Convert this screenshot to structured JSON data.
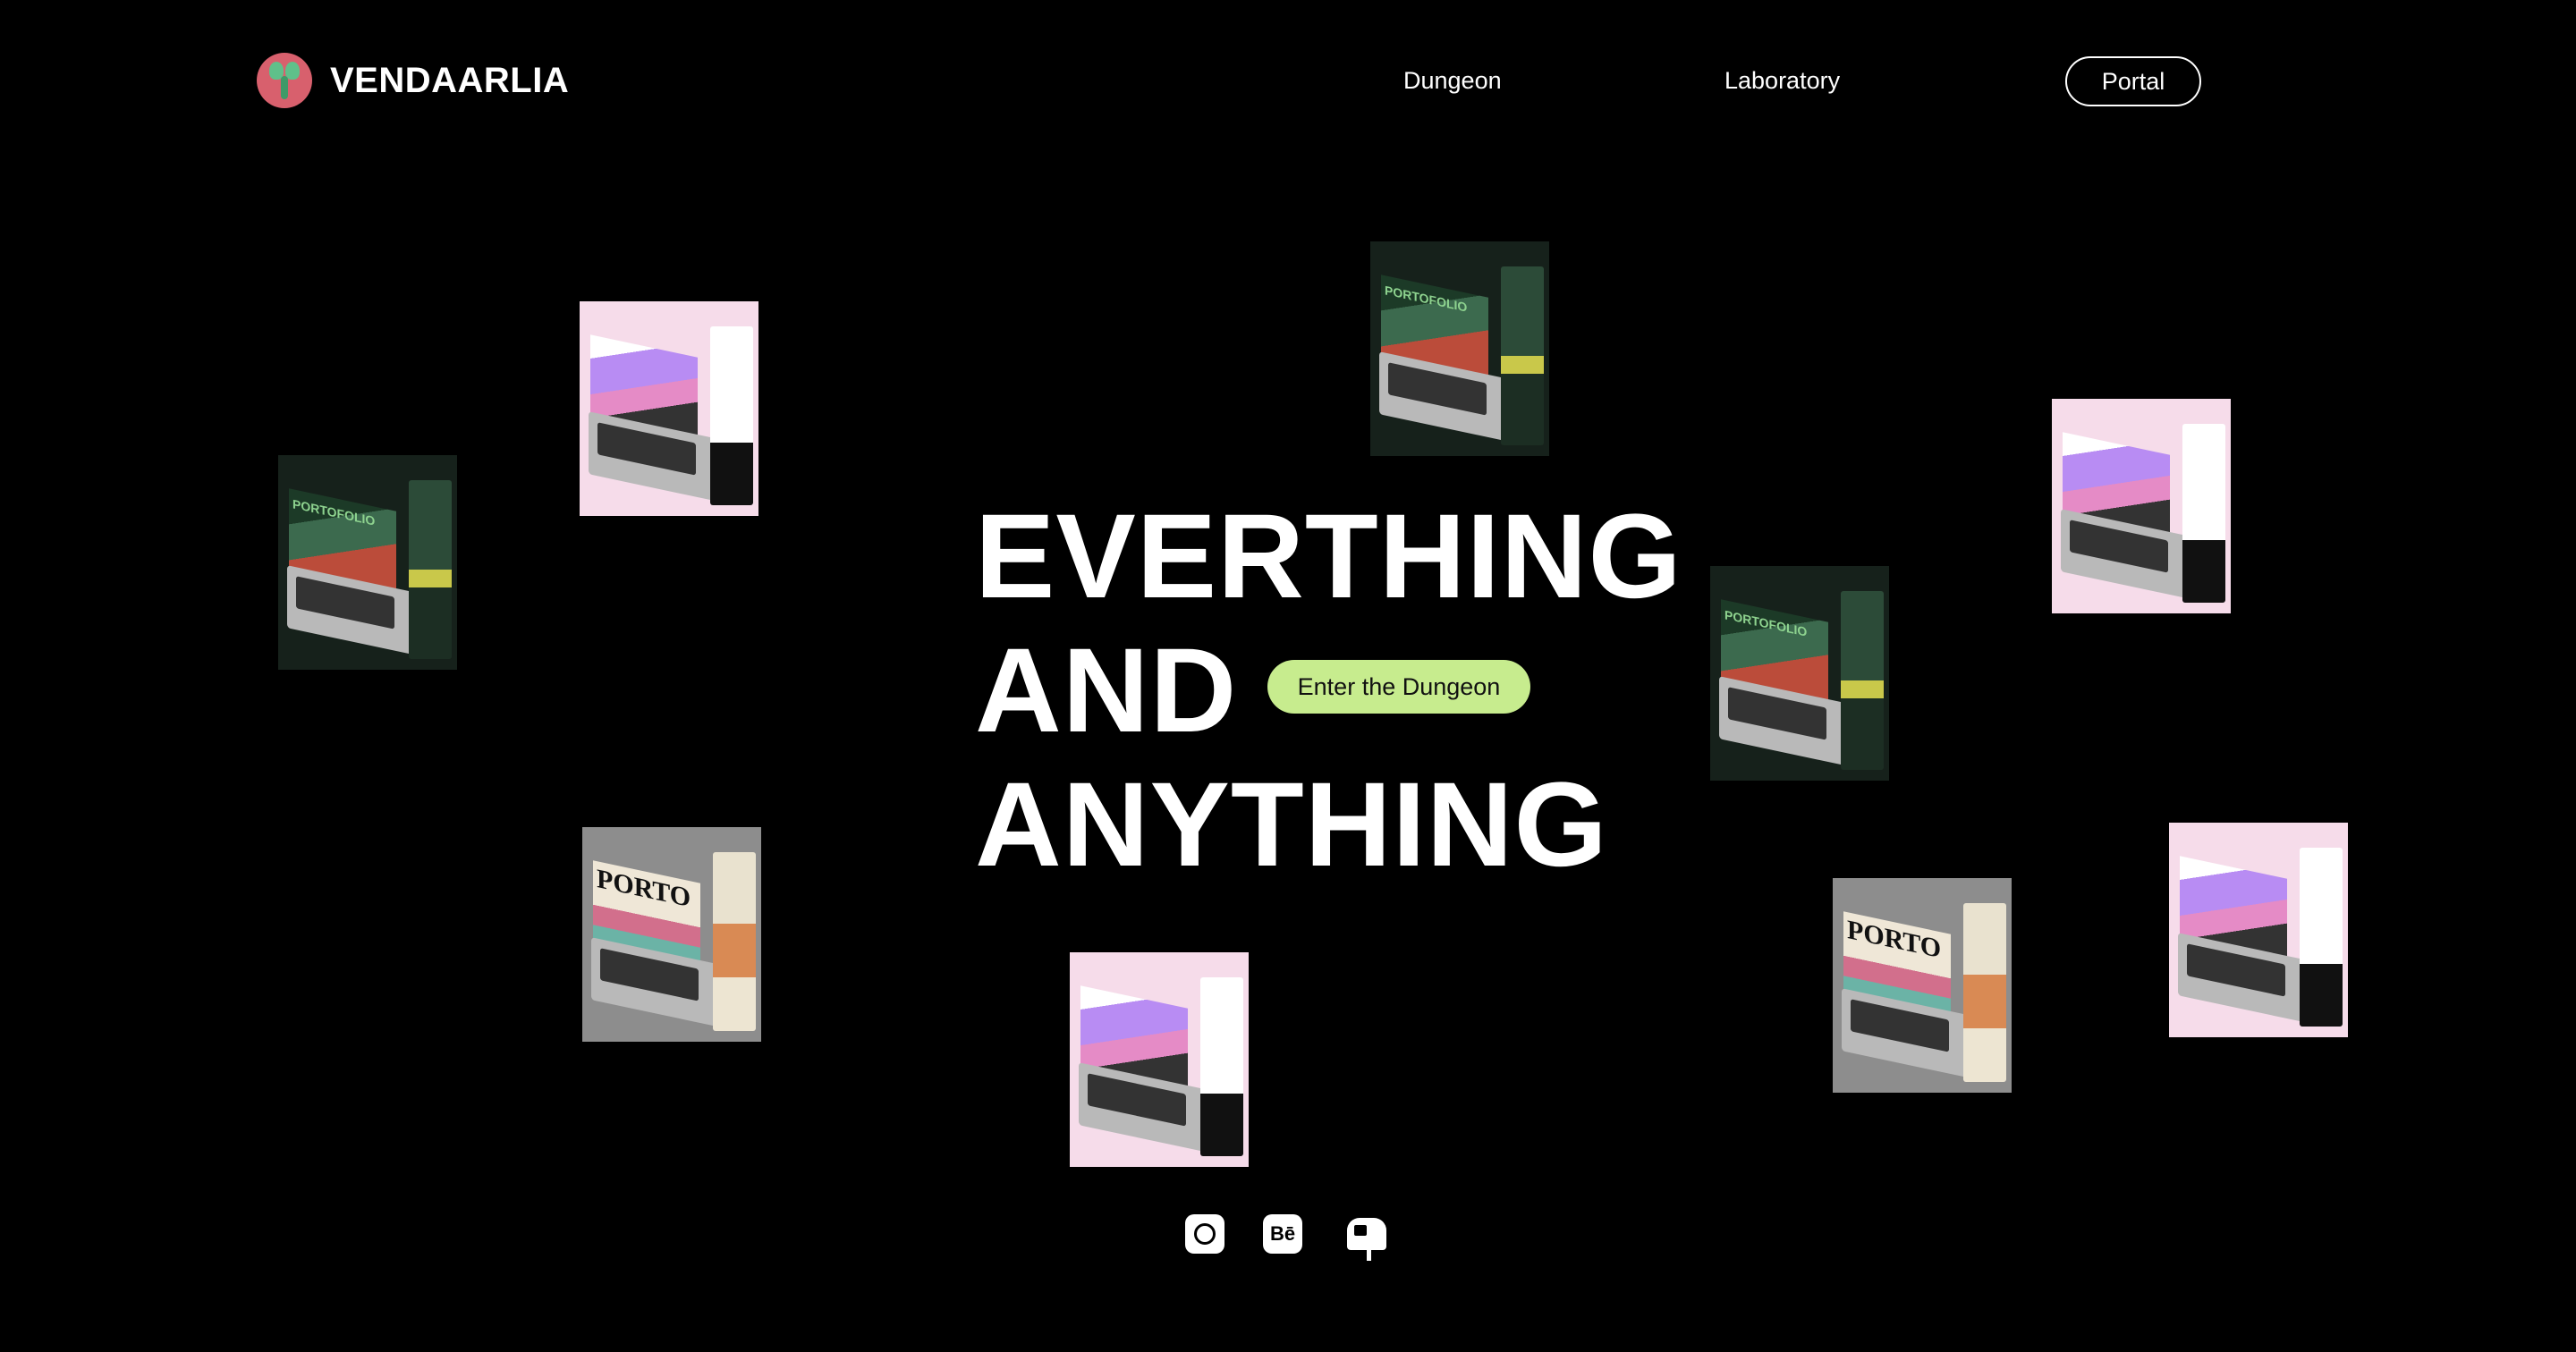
{
  "brand": {
    "name": "VENDAARLIA"
  },
  "nav": {
    "dungeon": "Dungeon",
    "laboratory": "Laboratory",
    "portal": "Portal"
  },
  "hero": {
    "line1": "EVERTHING",
    "line2": "AND",
    "line3": "ANYTHING",
    "cta_label": "Enter the Dungeon"
  },
  "thumbnails": [
    {
      "variant": "pink",
      "title": ""
    },
    {
      "variant": "dark",
      "title": "PORTOFOLIO"
    },
    {
      "variant": "dark",
      "title": "PORTOFOLIO"
    },
    {
      "variant": "pink",
      "title": ""
    },
    {
      "variant": "dark",
      "title": "PORTOFOLIO"
    },
    {
      "variant": "grey",
      "title": "PORTO"
    },
    {
      "variant": "pink",
      "title": ""
    },
    {
      "variant": "grey",
      "title": "PORTO"
    },
    {
      "variant": "pink",
      "title": ""
    }
  ],
  "social": {
    "behance_label": "Bē",
    "icons": [
      "instagram-icon",
      "behance-icon",
      "mailbox-icon"
    ]
  },
  "colors": {
    "background": "#000000",
    "accent": "#c7ec8e",
    "logo": "#d8606d"
  }
}
